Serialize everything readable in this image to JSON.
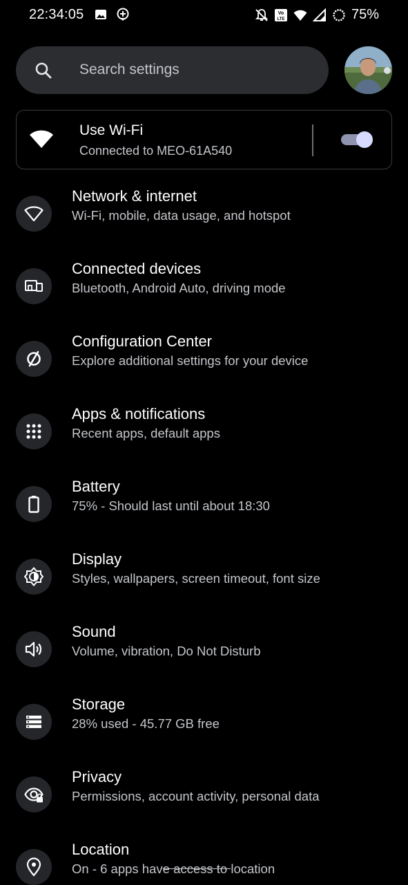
{
  "status_bar": {
    "time": "22:34:05",
    "battery": "75%",
    "left_icons": [
      "image-icon",
      "location-plus-icon"
    ],
    "right_icons": [
      "notifications-off-icon",
      "volte-icon",
      "wifi-signal-icon",
      "cell-signal-icon",
      "battery-ring-icon"
    ]
  },
  "search": {
    "placeholder": "Search settings"
  },
  "wifi_card": {
    "title": "Use Wi-Fi",
    "subtitle": "Connected to MEO-61A540",
    "enabled": true
  },
  "items": [
    {
      "title": "Network & internet",
      "subtitle": "Wi-Fi, mobile, data usage, and hotspot",
      "icon": "wifi-icon"
    },
    {
      "title": "Connected devices",
      "subtitle": "Bluetooth, Android Auto, driving mode",
      "icon": "devices-icon"
    },
    {
      "title": "Configuration Center",
      "subtitle": "Explore additional settings for your device",
      "icon": "config-icon"
    },
    {
      "title": "Apps & notifications",
      "subtitle": "Recent apps, default apps",
      "icon": "apps-grid-icon"
    },
    {
      "title": "Battery",
      "subtitle": "75% - Should last until about 18:30",
      "icon": "battery-icon"
    },
    {
      "title": "Display",
      "subtitle": "Styles, wallpapers, screen timeout, font size",
      "icon": "brightness-icon"
    },
    {
      "title": "Sound",
      "subtitle": "Volume, vibration, Do Not Disturb",
      "icon": "volume-icon"
    },
    {
      "title": "Storage",
      "subtitle": "28% used - 45.77 GB free",
      "icon": "storage-icon"
    },
    {
      "title": "Privacy",
      "subtitle": "Permissions, account activity, personal data",
      "icon": "privacy-eye-icon"
    },
    {
      "title": "Location",
      "subtitle_start": "On - 6 apps hav",
      "subtitle_strike": "e access to ",
      "subtitle_end": "location",
      "icon": "location-pin-icon"
    }
  ],
  "colors": {
    "background": "#000000",
    "surface": "#2b2d31",
    "icon_circle": "#24262a",
    "secondary_text": "#c4c6cb",
    "toggle_thumb": "#d6dbff",
    "toggle_track": "#8f93b0"
  }
}
